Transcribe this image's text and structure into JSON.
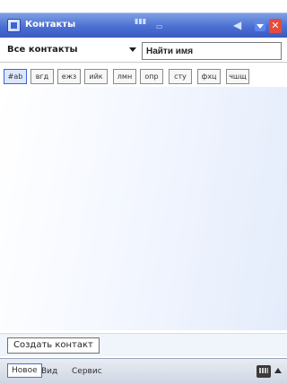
{
  "window": {
    "title": "Контакты",
    "status_icons": [
      "signal-icon",
      "battery-icon"
    ],
    "sound_icon": "speaker-icon",
    "ok_label": "✕"
  },
  "filter": {
    "dropdown_label": "Все контакты",
    "search_value": "Найти имя"
  },
  "letters": [
    {
      "label": "#ab"
    },
    {
      "label": "вгд"
    },
    {
      "label": "ежз"
    },
    {
      "label": "ийк"
    },
    {
      "label": "лмн"
    },
    {
      "label": "опр"
    },
    {
      "label": "сту"
    },
    {
      "label": "фхц"
    },
    {
      "label": "чшщ"
    }
  ],
  "list": {
    "items": []
  },
  "actions": {
    "create_contact_label": "Создать контакт"
  },
  "menubar": {
    "left_label": "Новое",
    "middle_label": "Вид",
    "right_label": "Сервис"
  }
}
